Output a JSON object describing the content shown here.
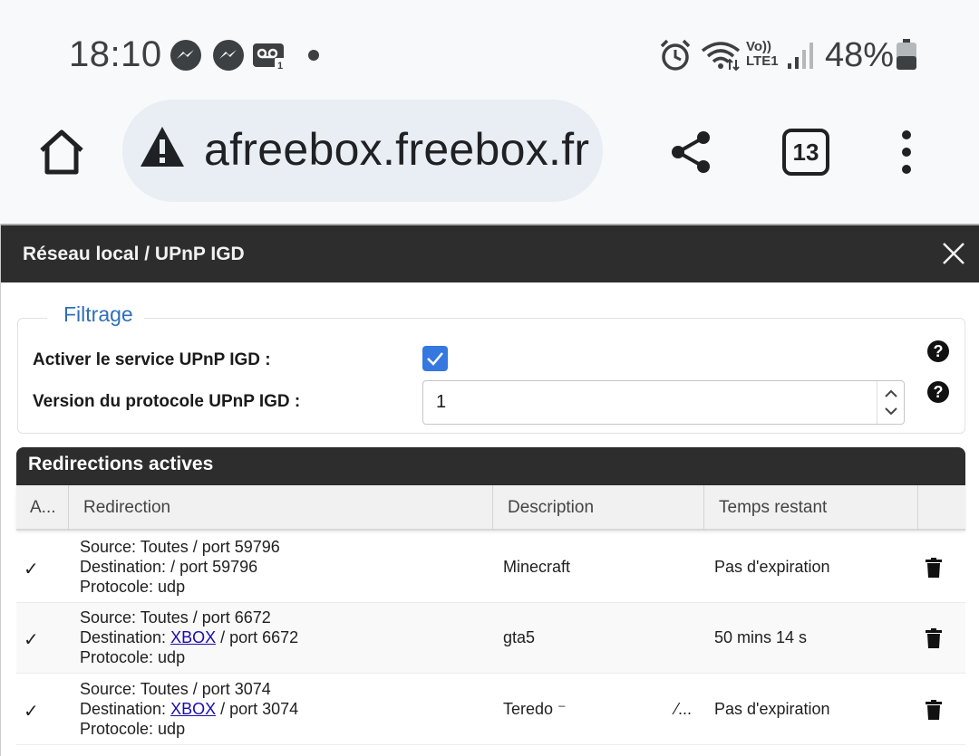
{
  "statusbar": {
    "time": "18:10",
    "battery_pct": "48%",
    "network_label": "Vo)) LTE1",
    "notif_badge": "1"
  },
  "browser": {
    "url": "afreebox.freebox.fr",
    "tab_count": "13"
  },
  "dialog": {
    "title": "Réseau local / UPnP IGD",
    "filter": {
      "legend": "Filtrage",
      "enable_label": "Activer le service UPnP IGD :",
      "enable_checked": true,
      "version_label": "Version du protocole UPnP IGD :",
      "version_value": "1",
      "help_glyph": "?"
    },
    "table": {
      "title": "Redirections actives",
      "headers": {
        "active": "A...",
        "redirection": "Redirection",
        "description": "Description",
        "remaining": "Temps restant"
      },
      "rows": [
        {
          "check": "✓",
          "source": "Source: Toutes / port 59796",
          "dest_prefix": "Destination: ",
          "dest_link": "",
          "dest_suffix": "/ port 59796",
          "protocol": "Protocole: udp",
          "description": "Minecraft",
          "remaining": "Pas d'expiration"
        },
        {
          "check": "✓",
          "source": "Source: Toutes / port 6672",
          "dest_prefix": "Destination: ",
          "dest_link": "XBOX",
          "dest_suffix": " / port 6672",
          "protocol": "Protocole: udp",
          "description": "gta5",
          "remaining": "50 mins 14 s"
        },
        {
          "check": "✓",
          "source": "Source: Toutes / port 3074",
          "dest_prefix": "Destination: ",
          "dest_link": "XBOX",
          "dest_suffix": " / port 3074",
          "protocol": "Protocole: udp",
          "description": "Teredo ⁻",
          "description_tail": "⁄...",
          "remaining": "Pas d'expiration"
        }
      ]
    }
  },
  "colors": {
    "header_dark": "#2d2d2d",
    "legend_blue": "#2f6fb8",
    "checkbox_blue": "#3478e0",
    "link": "#1a0dab"
  }
}
